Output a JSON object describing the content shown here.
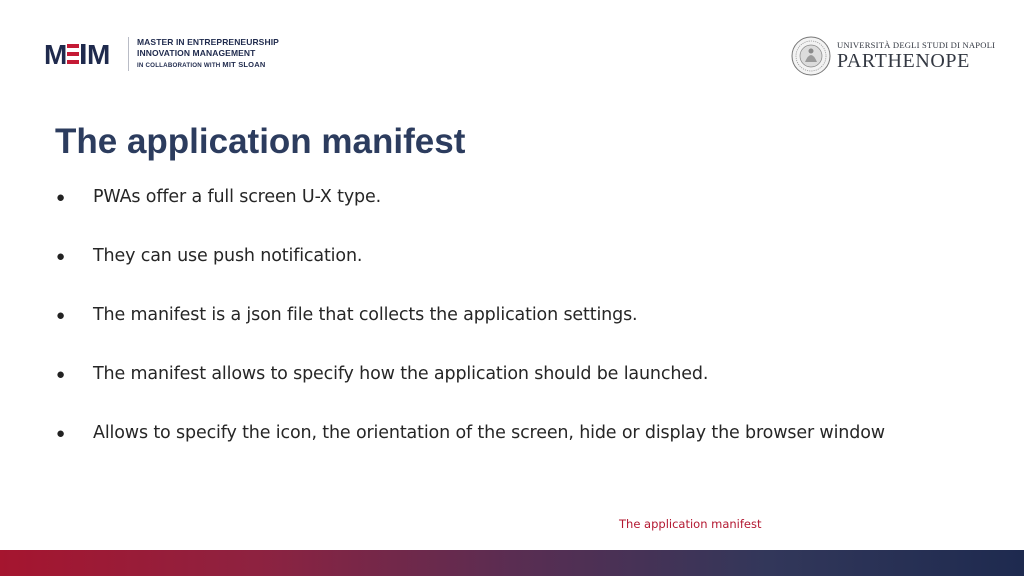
{
  "header": {
    "meim_logo": {
      "mark_text": "MEIM",
      "line1": "MASTER IN ENTREPRENEURSHIP",
      "line2": "INNOVATION MANAGEMENT",
      "line3_prefix": "IN COLLABORATION WITH",
      "line3_brand": "MIT SLOAN",
      "color": "#1f2a4d",
      "accent": "#c41a35"
    },
    "university_logo": {
      "top_text": "UNIVERSITÀ DEGLI STUDI DI NAPOLI",
      "name": "PARTHENOPE"
    }
  },
  "slide": {
    "title": "The application manifest",
    "bullets": [
      "PWAs offer a full screen U-X type.",
      "They can use push notification.",
      "The manifest is a json file that collects the application settings.",
      "The manifest allows to specify how the application should be launched.",
      "Allows to specify the icon, the orientation of the screen, hide or display the browser window"
    ],
    "bullet_symbol": "●",
    "footer": "The application manifest"
  },
  "colors": {
    "title": "#2c3c5e",
    "footer_text": "#b31831",
    "bar_start": "#a5152f",
    "bar_end": "#1e2a4f"
  }
}
